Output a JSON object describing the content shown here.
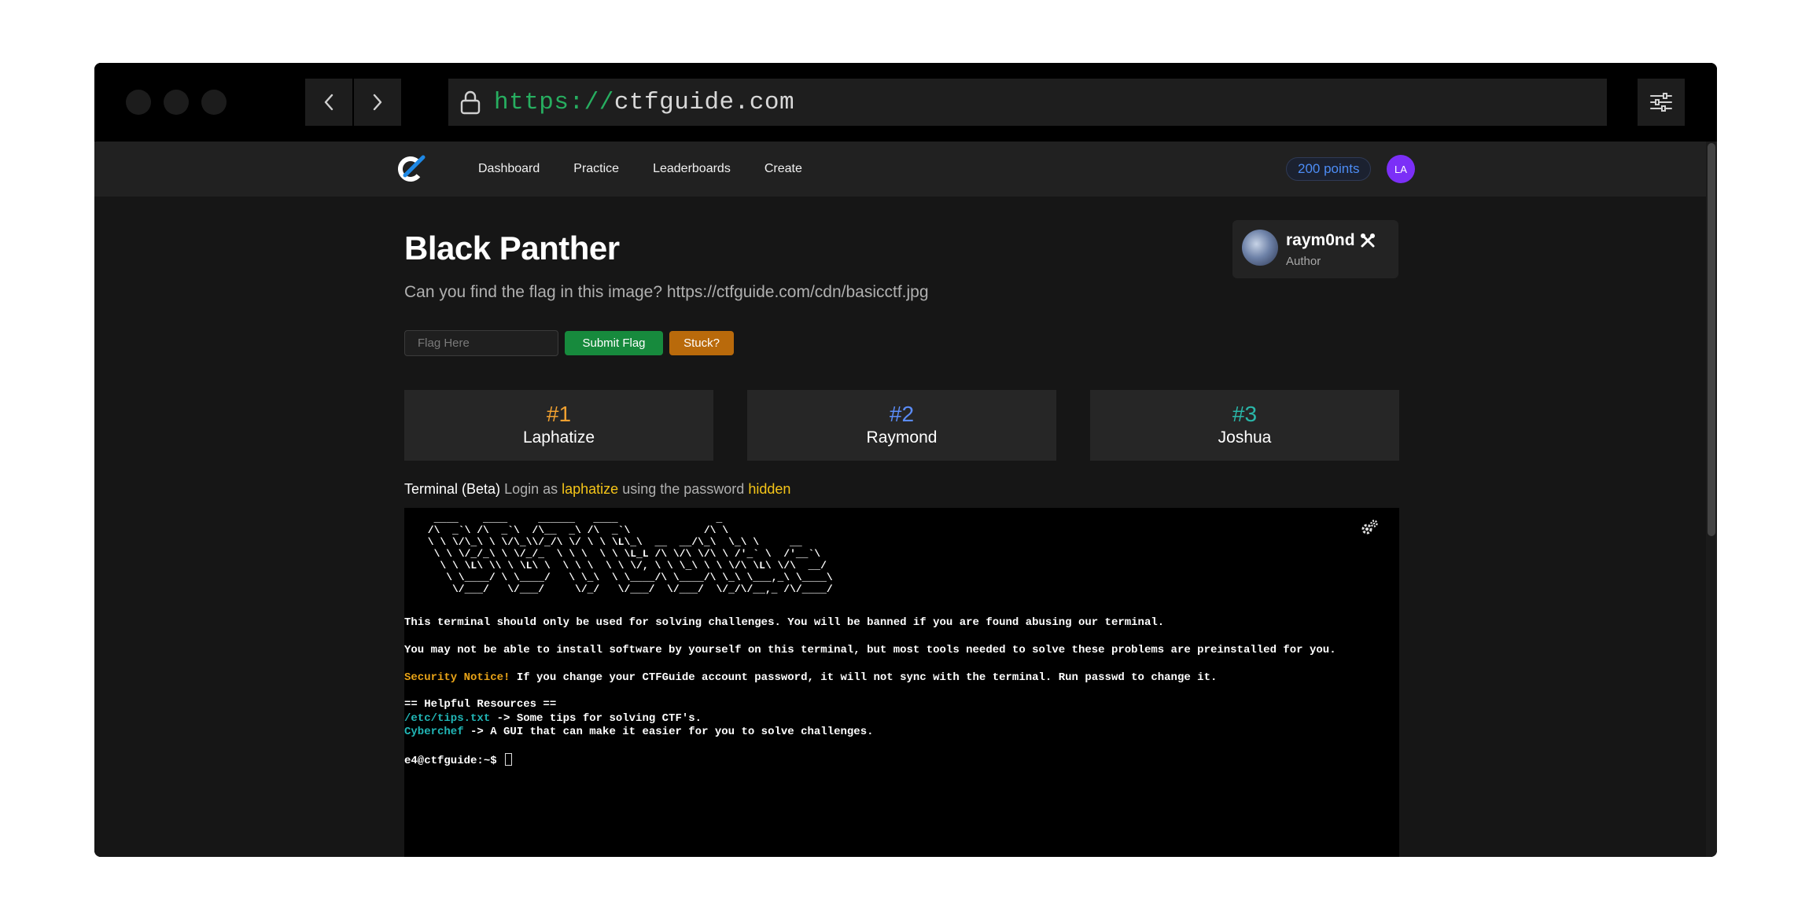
{
  "browser": {
    "url_scheme": "https://",
    "url_host": "ctfguide.com"
  },
  "nav": {
    "links": [
      "Dashboard",
      "Practice",
      "Leaderboards",
      "Create"
    ],
    "points": "200 points",
    "avatar_initials": "LA"
  },
  "challenge": {
    "title": "Black Panther",
    "description": "Can you find the flag in this image? https://ctfguide.com/cdn/basicctf.jpg",
    "flag_placeholder": "Flag Here",
    "submit_label": "Submit Flag",
    "stuck_label": "Stuck?"
  },
  "author": {
    "name": "raym0nd",
    "role": "Author"
  },
  "leaderboard": [
    {
      "rank": "#1",
      "name": "Laphatize",
      "color": "#f0a030"
    },
    {
      "rank": "#2",
      "name": "Raymond",
      "color": "#5b8cf7"
    },
    {
      "rank": "#3",
      "name": "Joshua",
      "color": "#2ab7a9"
    }
  ],
  "terminal_info": {
    "label": "Terminal (Beta)",
    "login_prefix": "Login as",
    "username": "laphatize",
    "password_prefix": "using the password",
    "password": "hidden"
  },
  "terminal": {
    "ascii_banner": "  ____    ____     ______   ____                _\n /\\  _`\\ /\\  _`\\  /\\__  _\\ /\\  _`\\            /\\ \\\n \\ \\ \\/\\_\\ \\ \\/\\_\\\\/_/\\ \\/ \\ \\ \\L\\_\\  __  __/\\_\\  \\_\\ \\     __\n  \\ \\ \\/_/_\\ \\ \\/_/_  \\ \\ \\  \\ \\ \\L_L /\\ \\/\\ \\/\\ \\ /'_` \\  /'__`\\\n   \\ \\ \\L\\ \\\\ \\ \\L\\ \\  \\ \\ \\  \\ \\ \\/, \\ \\ \\_\\ \\ \\ \\/\\ \\L\\ \\/\\  __/\n    \\ \\____/ \\ \\____/   \\ \\_\\  \\ \\____/\\ \\____/\\ \\_\\ \\___,_\\ \\____\\\n     \\/___/   \\/___/     \\/_/   \\/___/  \\/___/  \\/_/\\/__,_ /\\/____/",
    "line1": "This terminal should only be used for solving challenges. You will be banned if you are found abusing our terminal.",
    "line2": "You may not be able to install software by yourself on this terminal, but most tools needed to solve these problems are preinstalled for you.",
    "notice_label": "Security Notice!",
    "notice_text": " If you change your CTFGuide account password, it will not sync with the terminal. Run passwd to change it.",
    "resources_heading": "== Helpful Resources ==",
    "res1_link": "/etc/tips.txt",
    "res1_text": " -> Some tips for solving CTF's.",
    "res2_link": "Cyberchef",
    "res2_text": " -> A GUI that can make it easier for you to solve challenges.",
    "prompt": "e4@ctfguide:~$ "
  }
}
